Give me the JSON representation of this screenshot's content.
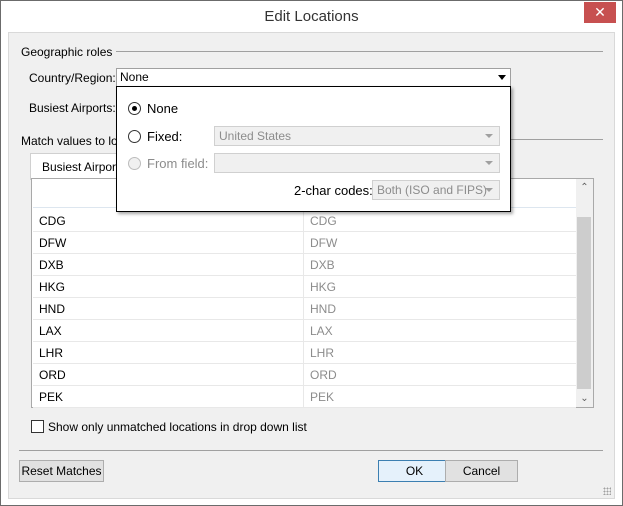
{
  "window": {
    "title": "Edit Locations",
    "close_label": "✕"
  },
  "geographic_roles": {
    "group_label": "Geographic roles",
    "country_label": "Country/Region:",
    "country_value": "None",
    "airports_label": "Busiest Airports:"
  },
  "match": {
    "label": "Match values to loca",
    "tab_label": "Busiest Airpor",
    "rows": [
      {
        "value": "CDG",
        "location": "CDG"
      },
      {
        "value": "DFW",
        "location": "DFW"
      },
      {
        "value": "DXB",
        "location": "DXB"
      },
      {
        "value": "HKG",
        "location": "HKG"
      },
      {
        "value": "HND",
        "location": "HND"
      },
      {
        "value": "LAX",
        "location": "LAX"
      },
      {
        "value": "LHR",
        "location": "LHR"
      },
      {
        "value": "ORD",
        "location": "ORD"
      },
      {
        "value": "PEK",
        "location": "PEK"
      }
    ],
    "scroll_up_icon": "chevron-up",
    "scroll_down_icon": "chevron-down"
  },
  "popup": {
    "option_none": "None",
    "option_fixed": "Fixed:",
    "fixed_value": "United States",
    "option_from_field": "From field:",
    "from_field_value": "",
    "two_char_label": "2-char codes:",
    "two_char_value": "Both (ISO and FIPS)",
    "selected": "None"
  },
  "checkbox": {
    "label": "Show only unmatched locations in drop down list",
    "checked": false
  },
  "buttons": {
    "reset": "Reset Matches",
    "ok": "OK",
    "cancel": "Cancel"
  }
}
